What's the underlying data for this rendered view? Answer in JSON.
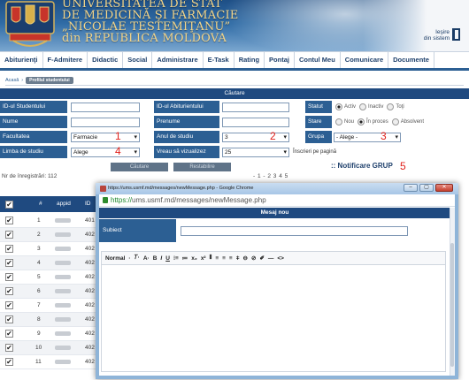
{
  "header": {
    "university_lines": [
      "UNIVERSITATEA DE STAT",
      "DE MEDICINĂ ŞI FARMACIE",
      "„NICOLAE TESTEMIŢANU”",
      "din REPUBLICA MOLDOVA"
    ],
    "logout_line1": "Ieşire",
    "logout_line2": "din sistem"
  },
  "menu": [
    "Abiturienţi",
    "F-Admitere",
    "Didactic",
    "Social",
    "Administrare",
    "E-Task",
    "Rating",
    "Pontaj",
    "Contul Meu",
    "Comunicare",
    "Documente"
  ],
  "breadcrumb": {
    "home": "Acasă",
    "current": "Profilul studentului"
  },
  "search": {
    "title": "Căutare",
    "labels": {
      "id_student": "ID-ul Studentului",
      "id_abiturient": "ID-ul Abiturientului",
      "statut": "Statut",
      "nume": "Nume",
      "prenume": "Prenume",
      "stare": "Stare",
      "facultatea": "Facultatea",
      "anul": "Anul de studiu",
      "grupa": "Grupa",
      "limba": "Limba de studiu",
      "vizualizez": "Vreau să vizualizez"
    },
    "statut_options": [
      "Activ",
      "Inactiv",
      "Toţi"
    ],
    "stare_options": [
      "Nou",
      "În proces",
      "Absolvent"
    ],
    "values": {
      "facultatea": "Farmacie",
      "anul": "3",
      "grupa": "- Alege -",
      "limba": "Alege",
      "vizualizez": "25"
    },
    "inscrieri_label": "Înscrieri pe pagină",
    "cautare_button": "Căutare",
    "restabilire_button": "Restabilire",
    "notif_label": ":: Notificare GRUP",
    "annotations": [
      "1",
      "2",
      "3",
      "4",
      "5"
    ]
  },
  "records_label": "Nr de înregistrări: 112",
  "pagination": "- 1 - 2 3 4 5",
  "table": {
    "headers": [
      "#",
      "appid",
      "ID"
    ],
    "rows": [
      {
        "n": "1",
        "id": "401"
      },
      {
        "n": "2",
        "id": "402"
      },
      {
        "n": "3",
        "id": "402"
      },
      {
        "n": "4",
        "id": "402"
      },
      {
        "n": "5",
        "id": "402"
      },
      {
        "n": "6",
        "id": "402"
      },
      {
        "n": "7",
        "id": "402"
      },
      {
        "n": "8",
        "id": "402"
      },
      {
        "n": "9",
        "id": "402"
      },
      {
        "n": "10",
        "id": "402"
      },
      {
        "n": "11",
        "id": "402"
      }
    ]
  },
  "popup": {
    "window_title": "https://ums.usmf.md/messages/newMessage.php - Google Chrome",
    "url_scheme": "https://",
    "url_rest": "ums.usmf.md/messages/newMessage.php",
    "panel_title": "Mesaj nou",
    "subject_label": "Subiect",
    "toolbar": [
      "Normal",
      "·",
      "𝑇·",
      "A·",
      "B",
      "I",
      "U",
      "⁝≡",
      "≔",
      "x₂",
      "x²",
      "⫴",
      "≡",
      "≡",
      "≡",
      "ǂ",
      "⊖",
      "⊘",
      "✐",
      "—",
      "<>"
    ]
  },
  "colors": {
    "accent": "#1f4a80",
    "label_bg": "#2c5f93",
    "annotation": "#e0201a"
  }
}
